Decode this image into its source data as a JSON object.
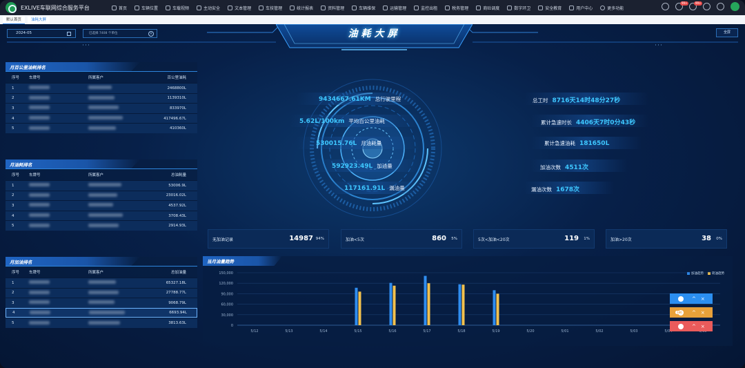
{
  "app": {
    "title": "EXLIVE车联网综合服务平台",
    "menu": [
      "首页",
      "车辆位置",
      "车载视频",
      "主动安全",
      "文本管理",
      "车技管理",
      "统计报表",
      "资料管理",
      "车辆维保",
      "运输管理",
      "监控出租",
      "税务管理",
      "商砼调度",
      "数字环卫",
      "安全教育",
      "用户中心",
      "更多功能"
    ],
    "badges": [
      "99+",
      "99+"
    ]
  },
  "tabs": [
    "默认首页",
    "油耗大屏"
  ],
  "toolbar": {
    "date": "2024-05",
    "vehicles_placeholder": "已选择 7408 个单位",
    "fullscreen": "全屏"
  },
  "dashboard_title": "油耗大屏",
  "tables": [
    {
      "title": "月百公里油耗排名",
      "headers": [
        "序号",
        "车牌号",
        "所属客户",
        "百公里油耗"
      ],
      "rows": [
        {
          "idx": "1",
          "val": "2468800L"
        },
        {
          "idx": "2",
          "val": "1139310L"
        },
        {
          "idx": "3",
          "val": "833970L"
        },
        {
          "idx": "4",
          "val": "417496.67L"
        },
        {
          "idx": "5",
          "val": "410360L"
        }
      ]
    },
    {
      "title": "月油耗排名",
      "headers": [
        "序号",
        "车牌号",
        "所属客户",
        "总油耗量"
      ],
      "rows": [
        {
          "idx": "1",
          "val": "53006.9L"
        },
        {
          "idx": "2",
          "val": "23016.02L"
        },
        {
          "idx": "3",
          "val": "4537.92L"
        },
        {
          "idx": "4",
          "val": "3708.43L"
        },
        {
          "idx": "5",
          "val": "2914.93L"
        }
      ]
    },
    {
      "title": "月加油排名",
      "headers": [
        "序号",
        "车牌号",
        "所属客户",
        "总加油量"
      ],
      "rows": [
        {
          "idx": "1",
          "val": "65327.18L"
        },
        {
          "idx": "2",
          "val": "27788.77L"
        },
        {
          "idx": "3",
          "val": "9068.79L"
        },
        {
          "idx": "4",
          "val": "6693.94L"
        },
        {
          "idx": "5",
          "val": "3813.63L"
        }
      ]
    }
  ],
  "stats_left": [
    {
      "value": "9434667.61KM",
      "label": "总行驶里程"
    },
    {
      "value": "5.62L/100km",
      "label": "平均百公里油耗"
    },
    {
      "value": "530015.76L",
      "label": "月油耗量"
    },
    {
      "value": "592923.49L",
      "label": "加油量"
    },
    {
      "value": "117161.91L",
      "label": "漏油量"
    }
  ],
  "stats_right": [
    {
      "label": "总工时",
      "value": "8716天14时48分27秒"
    },
    {
      "label": "累计急速时长",
      "value": "4406天7时0分43秒"
    },
    {
      "label": "累计急速油耗",
      "value": "181650L"
    },
    {
      "label": "加油次数",
      "value": "4511次"
    },
    {
      "label": "漏油次数",
      "value": "1678次"
    }
  ],
  "refuel_cards": [
    {
      "label": "无加油记录",
      "value": "14987",
      "pct": "94%"
    },
    {
      "label": "加油<5次",
      "value": "860",
      "pct": "5%"
    },
    {
      "label": "5次<加油<20次",
      "value": "119",
      "pct": "1%"
    },
    {
      "label": "加油>20次",
      "value": "38",
      "pct": "0%"
    }
  ],
  "floating": [
    {
      "color": "#2b8ef0",
      "badge": ""
    },
    {
      "color": "#e8a13a",
      "badge": "186"
    },
    {
      "color": "#ea5b5b",
      "badge": ""
    }
  ],
  "chart_data": {
    "type": "bar",
    "title": "当月油量趋势",
    "categories": [
      "5/12",
      "5/13",
      "5/14",
      "5/15",
      "5/16",
      "5/17",
      "5/18",
      "5/19",
      "5/20",
      "5/01",
      "5/02",
      "5/03",
      "5/04",
      "5/05"
    ],
    "series": [
      {
        "name": "加油趋势",
        "color": "#2f8df0",
        "values": [
          0,
          0,
          0,
          107000,
          121000,
          141000,
          117000,
          100000,
          0,
          0,
          0,
          0,
          0,
          0
        ]
      },
      {
        "name": "耗油趋势",
        "color": "#f2c14e",
        "values": [
          0,
          0,
          0,
          96000,
          113000,
          120000,
          116000,
          90000,
          0,
          0,
          0,
          0,
          0,
          0
        ]
      }
    ],
    "yticks": [
      "150,000",
      "120,000",
      "90,000",
      "60,000",
      "30,000",
      "0"
    ],
    "ylim": [
      0,
      150000
    ],
    "legend": "top-right"
  }
}
